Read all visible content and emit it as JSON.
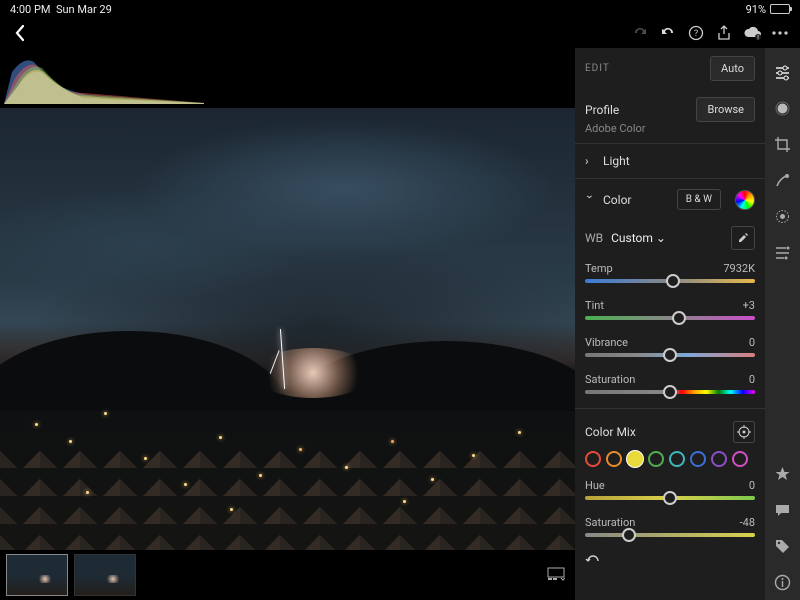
{
  "status": {
    "time": "4:00 PM",
    "date": "Sun Mar 29",
    "battery_pct": "91%"
  },
  "topbar_icons": [
    "redo",
    "undo",
    "help",
    "share",
    "cloud-alert",
    "more"
  ],
  "edit": {
    "header": "EDIT",
    "auto_label": "Auto",
    "profile_label": "Profile",
    "profile_value": "Adobe Color",
    "browse_label": "Browse",
    "light_label": "Light",
    "color_label": "Color",
    "bw_label": "B & W",
    "wb_label": "WB",
    "wb_value": "Custom",
    "sliders": {
      "temp": {
        "label": "Temp",
        "value": "7932K",
        "pos": 52
      },
      "tint": {
        "label": "Tint",
        "value": "+3",
        "pos": 55
      },
      "vibrance": {
        "label": "Vibrance",
        "value": "0",
        "pos": 50
      },
      "saturation": {
        "label": "Saturation",
        "value": "0",
        "pos": 50
      },
      "hue": {
        "label": "Hue",
        "value": "0",
        "pos": 50
      },
      "mix_sat": {
        "label": "Saturation",
        "value": "-48",
        "pos": 26
      }
    },
    "colormix_label": "Color Mix",
    "mix_colors": [
      "#e24b3b",
      "#e88b2d",
      "#e7da3a",
      "#4fae4f",
      "#3fb8b8",
      "#3b6fd6",
      "#8a4fc9",
      "#d14fc1"
    ],
    "mix_selected_index": 2
  },
  "tools": [
    "sliders",
    "circle",
    "crop",
    "heal",
    "radial",
    "local",
    "spacer",
    "star",
    "comment",
    "tag",
    "info"
  ]
}
